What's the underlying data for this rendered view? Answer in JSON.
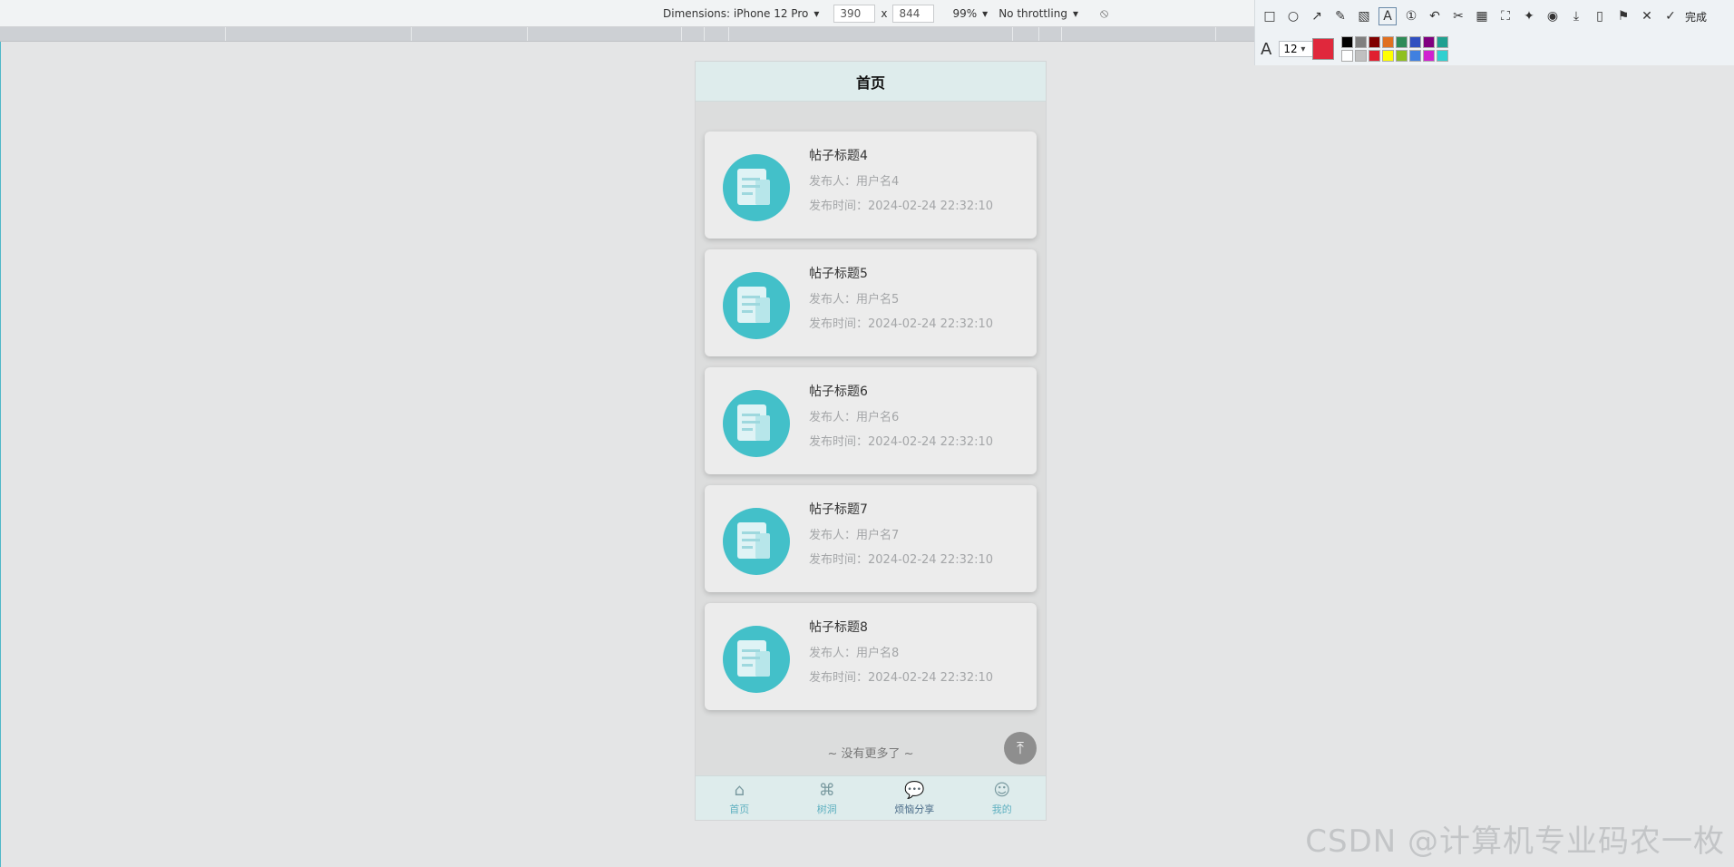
{
  "devtools": {
    "dimensions_label": "Dimensions: iPhone 12 Pro",
    "width": "390",
    "times": "x",
    "height": "844",
    "zoom": "99%",
    "throttling": "No throttling"
  },
  "annotation_toolbar": {
    "done_label": "完成",
    "font_size": "12",
    "current_color": "#e0283c",
    "palette": [
      "#000000",
      "#808080",
      "#800000",
      "#e07020",
      "#2e8b57",
      "#3050c0",
      "#800080",
      "#20a090",
      "#ffffff",
      "#c0c0c0",
      "#e02030",
      "#ffff00",
      "#90c020",
      "#4080e0",
      "#d020d0",
      "#30d0d0"
    ]
  },
  "app": {
    "title": "首页",
    "posts": [
      {
        "title": "帖子标题4",
        "author": "发布人：用户名4",
        "time": "发布时间：2024-02-24 22:32:10"
      },
      {
        "title": "帖子标题5",
        "author": "发布人：用户名5",
        "time": "发布时间：2024-02-24 22:32:10"
      },
      {
        "title": "帖子标题6",
        "author": "发布人：用户名6",
        "time": "发布时间：2024-02-24 22:32:10"
      },
      {
        "title": "帖子标题7",
        "author": "发布人：用户名7",
        "time": "发布时间：2024-02-24 22:32:10"
      },
      {
        "title": "帖子标题8",
        "author": "发布人：用户名8",
        "time": "发布时间：2024-02-24 22:32:10"
      }
    ],
    "no_more": "~ 没有更多了 ~",
    "tabs": [
      {
        "label": "首页",
        "icon": "home-icon"
      },
      {
        "label": "树洞",
        "icon": "treehole-icon"
      },
      {
        "label": "烦恼分享",
        "icon": "chat-bubble-icon"
      },
      {
        "label": "我的",
        "icon": "user-icon"
      }
    ]
  },
  "watermark": "CSDN @计算机专业码农一枚"
}
